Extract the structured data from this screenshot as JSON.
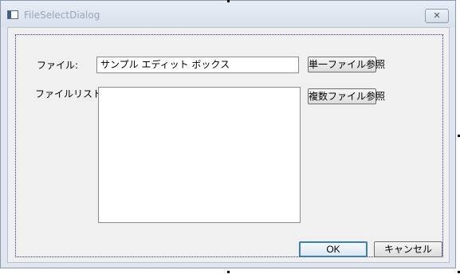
{
  "window": {
    "title": "FileSelectDialog",
    "close_symbol": "✕"
  },
  "form": {
    "file_label": "ファイル:",
    "file_value": "サンプル エディット ボックス",
    "file_list_label": "ファイルリスト:",
    "file_list_items": []
  },
  "buttons": {
    "single_file_browse": "単一ファイル参照",
    "multi_file_browse": "複数ファイル参照",
    "ok": "OK",
    "cancel": "キャンセル"
  },
  "icons": {
    "app": "window-app-icon",
    "close": "close-icon"
  }
}
